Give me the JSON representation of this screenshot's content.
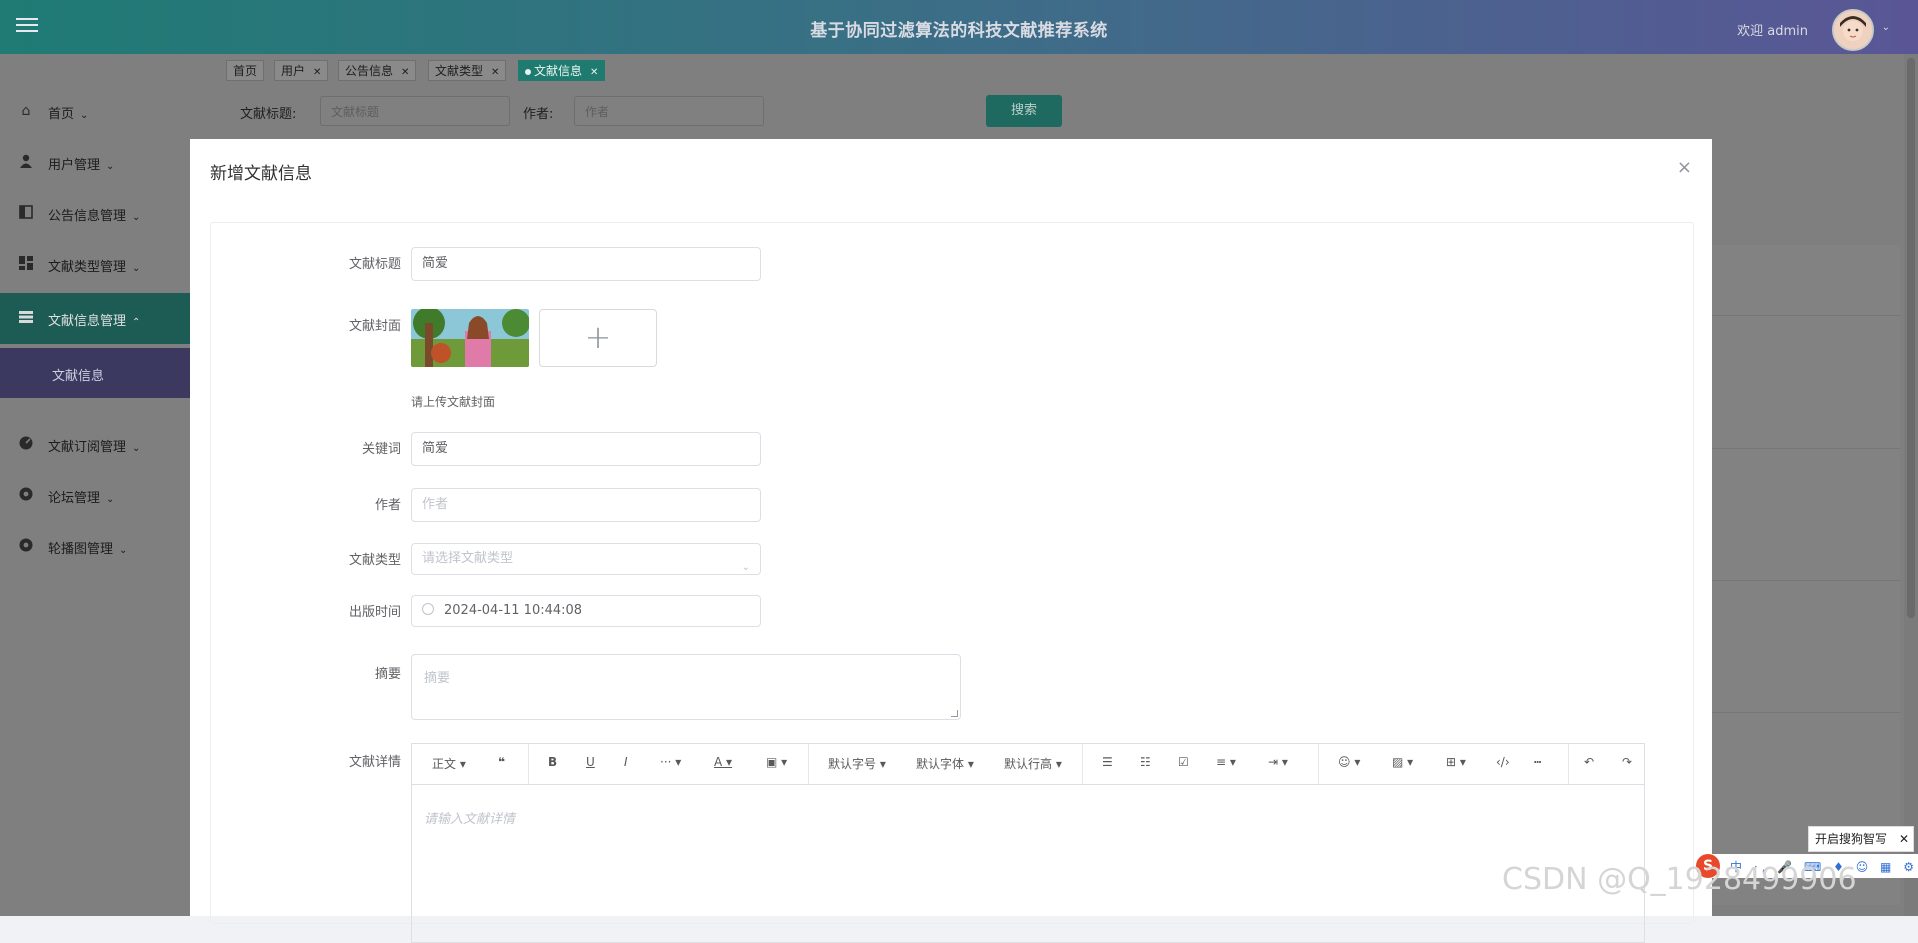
{
  "header": {
    "title": "基于协同过滤算法的科技文献推荐系统",
    "welcome": "欢迎 admin"
  },
  "tabs": [
    {
      "label": "首页",
      "closable": false
    },
    {
      "label": "用户",
      "closable": true
    },
    {
      "label": "公告信息",
      "closable": true
    },
    {
      "label": "文献类型",
      "closable": true
    },
    {
      "label": "文献信息",
      "closable": true,
      "active": true
    }
  ],
  "sidebar": {
    "items": [
      {
        "label": "首页",
        "icon": "home-icon"
      },
      {
        "label": "用户管理",
        "icon": "user-icon"
      },
      {
        "label": "公告信息管理",
        "icon": "notice-icon"
      },
      {
        "label": "文献类型管理",
        "icon": "grid-icon"
      },
      {
        "label": "文献信息管理",
        "icon": "list-icon",
        "expanded": true
      },
      {
        "label": "文献订阅管理",
        "icon": "gauge-icon"
      },
      {
        "label": "论坛管理",
        "icon": "circle-icon"
      },
      {
        "label": "轮播图管理",
        "icon": "circle-icon"
      }
    ],
    "sub_item": "文献信息"
  },
  "search": {
    "title_label": "文献标题:",
    "title_placeholder": "文献标题",
    "author_label": "作者:",
    "author_placeholder": "作者",
    "button": "搜索"
  },
  "dialog": {
    "title": "新增文献信息",
    "close": "×",
    "fields": {
      "title_label": "文献标题",
      "title_value": "简爱",
      "cover_label": "文献封面",
      "cover_tip": "请上传文献封面",
      "keywords_label": "关键词",
      "keywords_value": "简爱",
      "author_label": "作者",
      "author_placeholder": "作者",
      "type_label": "文献类型",
      "type_placeholder": "请选择文献类型",
      "date_label": "出版时间",
      "date_value": "2024-04-11 10:44:08",
      "abstract_label": "摘要",
      "abstract_placeholder": "摘要",
      "detail_label": "文献详情",
      "detail_placeholder": "请输入文献详情"
    },
    "editor_toolbar": {
      "paragraph": "正文",
      "font_size": "默认字号",
      "font_family": "默认字体",
      "line_height": "默认行高"
    }
  },
  "ime": {
    "tip": "开启搜狗智写"
  },
  "watermark": "CSDN @Q_1928499906",
  "colors": {
    "header_start": "#1f7b74",
    "header_end": "#5a5696",
    "active_menu": "#1d5c55",
    "search_button": "#1f6a60"
  }
}
